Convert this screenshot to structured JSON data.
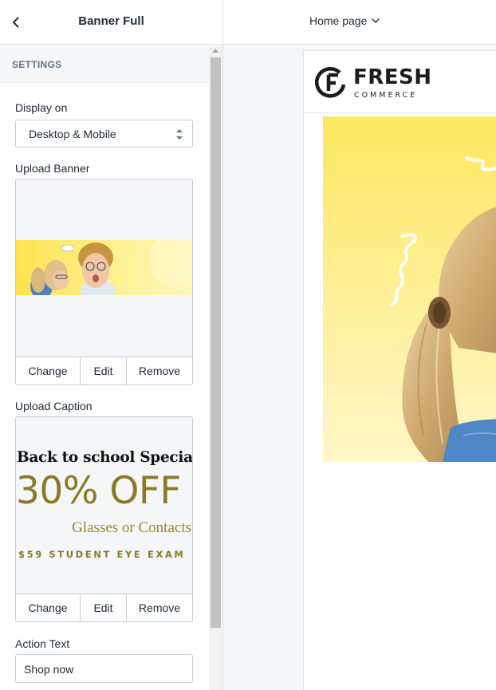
{
  "panel": {
    "title": "Banner Full",
    "section": "SETTINGS",
    "display_on": {
      "label": "Display on",
      "value": "Desktop & Mobile"
    },
    "upload_banner": {
      "label": "Upload Banner",
      "actions": [
        "Change",
        "Edit",
        "Remove"
      ]
    },
    "upload_caption": {
      "label": "Upload Caption",
      "caption_lines": [
        "Back to school Special",
        "30% OFF",
        "Glasses or Contacts",
        "$59 STUDENT EYE EXAM"
      ],
      "actions": [
        "Change",
        "Edit",
        "Remove"
      ]
    },
    "action_text": {
      "label": "Action Text",
      "value": "Shop now"
    }
  },
  "preview": {
    "page_selector": "Home page",
    "store": {
      "logo_name": "FRESH",
      "logo_sub": "COMMERCE"
    }
  },
  "colors": {
    "border": "#c4cdd5",
    "panel_bg": "#f4f6f8",
    "caption_gold": "#8a7a28",
    "banner_yellow": "#fde96a"
  }
}
